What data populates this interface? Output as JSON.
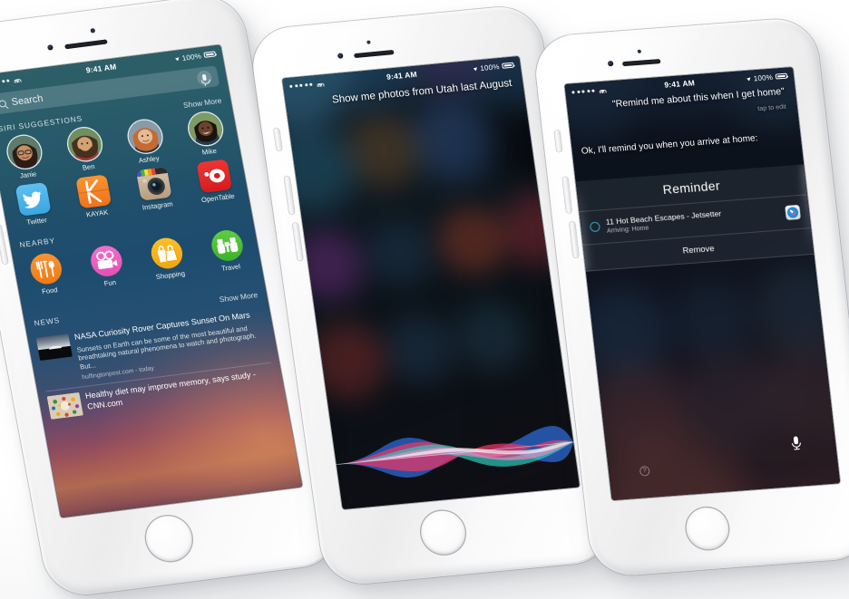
{
  "scene": {
    "title": "iOS 9 Siri and Proactive Spotlight on three iPhone 6 devices",
    "background_color": "#ffffff",
    "device_finish": "Silver / White iPhone 6"
  },
  "status_bar": {
    "carrier_dots": 5,
    "wifi_icon": "wifi-icon",
    "time": "9:41 AM",
    "location_icon": "location-arrow-icon",
    "battery_percent": "100%",
    "battery_icon": "battery-full-icon"
  },
  "phone1": {
    "label": "Proactive Spotlight search screen",
    "search": {
      "placeholder": "Search",
      "search_icon": "search-icon",
      "mic_icon": "microphone-icon"
    },
    "siri_suggestions": {
      "header": "SIRI SUGGESTIONS",
      "show_more": "Show More",
      "contacts": [
        {
          "name": "Janie"
        },
        {
          "name": "Ben"
        },
        {
          "name": "Ashley"
        },
        {
          "name": "Mike"
        }
      ],
      "apps": [
        {
          "name": "Twitter",
          "color": "#4cb3e8",
          "glyph": "twitter-bird-icon"
        },
        {
          "name": "KAYAK",
          "color": "#f57c20",
          "glyph": "kayak-k-icon"
        },
        {
          "name": "Instagram",
          "color": "#c7b29a",
          "glyph": "instagram-camera-icon"
        },
        {
          "name": "OpenTable",
          "color": "#e02b2b",
          "glyph": "opentable-dot-icon"
        }
      ]
    },
    "nearby": {
      "header": "NEARBY",
      "items": [
        {
          "name": "Food",
          "color": "#f5881f",
          "glyph": "cutlery-icon"
        },
        {
          "name": "Fun",
          "color": "#ee5fbe",
          "glyph": "movie-camera-icon"
        },
        {
          "name": "Shopping",
          "color": "#f5b317",
          "glyph": "shopping-bag-icon"
        },
        {
          "name": "Travel",
          "color": "#4ec13c",
          "glyph": "binoculars-icon"
        }
      ]
    },
    "news": {
      "header": "NEWS",
      "show_more": "Show More",
      "items": [
        {
          "title": "NASA Curiosity Rover Captures Sunset On Mars",
          "body": "Sunsets on Earth can be some of the most beautiful and breathtaking natural phenomena to watch and photograph. But...",
          "source": "huffingtonpost.com - today",
          "thumb": "mars-sunset-thumbnail"
        },
        {
          "title": "Healthy diet may improve memory, says study - CNN.com",
          "body": "",
          "source": "",
          "thumb": "healthy-food-thumbnail"
        }
      ]
    }
  },
  "phone2": {
    "label": "Siri listening screen",
    "query": "Show me photos from Utah last August",
    "waveform": "siri-waveform",
    "waveform_colors": [
      "#2f6fe0",
      "#ff3b6b",
      "#2fd4c4",
      "#ff8fd0",
      "#ffffff"
    ]
  },
  "phone3": {
    "label": "Siri reminder confirmation screen",
    "query": "\"Remind me about this when I get home\"",
    "tap_to_edit": "tap to edit",
    "answer": "Ok, I'll remind you when you arrive at home:",
    "card": {
      "title": "Reminder",
      "item_title": "11 Hot Beach Escapes - Jetsetter",
      "item_subtitle": "Arriving: Home",
      "app_icon": "safari-icon",
      "checkbox": "reminder-checkbox",
      "remove_label": "Remove"
    },
    "mic_icon": "microphone-icon",
    "help_icon": "help-question-icon",
    "accent_color": "#3aa2cf"
  }
}
